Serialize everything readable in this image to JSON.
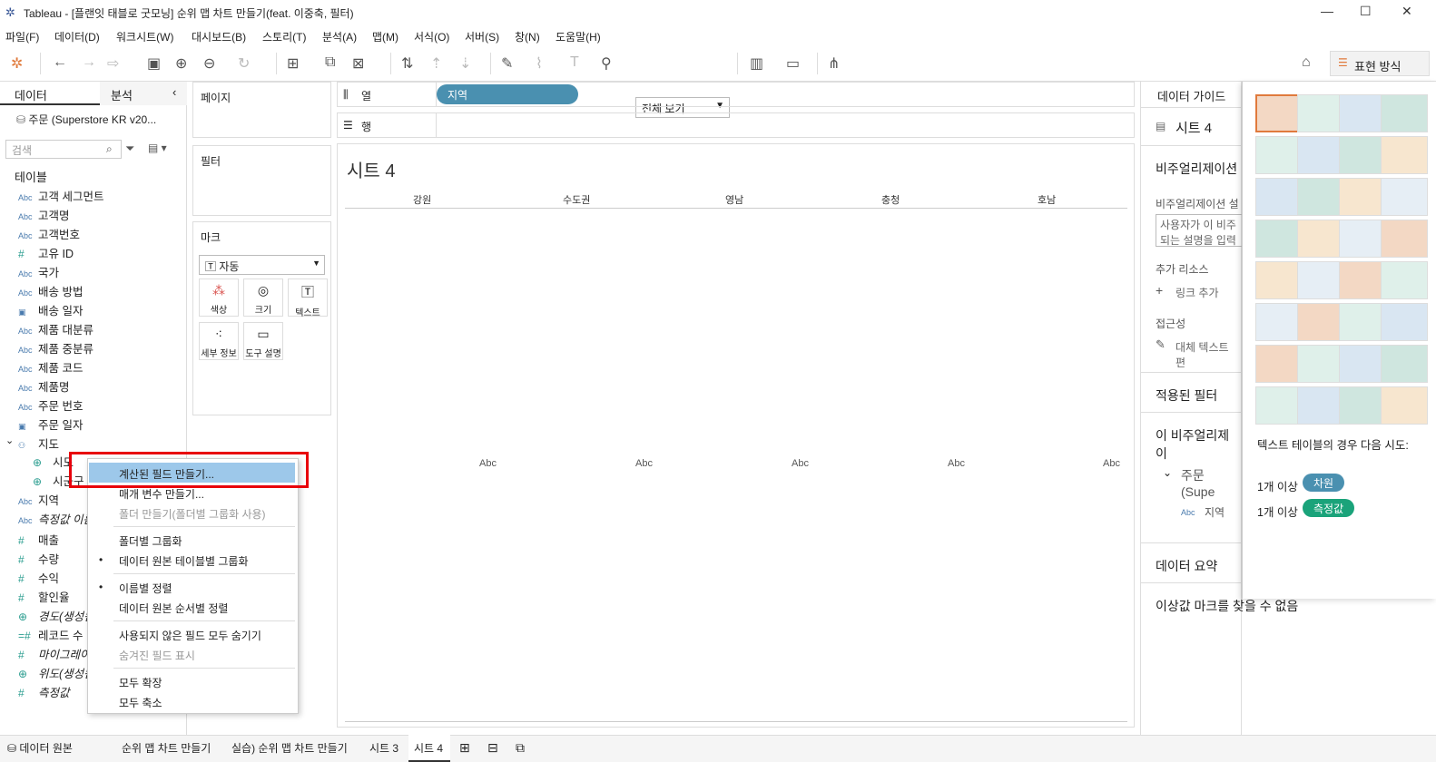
{
  "window": {
    "title": "Tableau - [플랜잇 태블로 굿모닝] 순위 맵 차트 만들기(feat. 이중축, 필터)"
  },
  "menu": [
    "파일(F)",
    "데이터(D)",
    "워크시트(W)",
    "대시보드(B)",
    "스토리(T)",
    "분석(A)",
    "맵(M)",
    "서식(O)",
    "서버(S)",
    "창(N)",
    "도움말(H)"
  ],
  "toolbar": {
    "view_label": "전체 보기",
    "showme_label": "표현 방식"
  },
  "left": {
    "tab_data": "데이터",
    "tab_analysis": "분석",
    "source": "주문 (Superstore KR v20...",
    "search_placeholder": "검색",
    "tables_label": "테이블",
    "fields": [
      {
        "icon": "Abc",
        "name": "고객 세그먼트"
      },
      {
        "icon": "Abc",
        "name": "고객명"
      },
      {
        "icon": "Abc",
        "name": "고객번호"
      },
      {
        "icon": "#",
        "name": "고유 ID"
      },
      {
        "icon": "Abc",
        "name": "국가"
      },
      {
        "icon": "Abc",
        "name": "배송 방법"
      },
      {
        "icon": "cal",
        "name": "배송 일자"
      },
      {
        "icon": "Abc",
        "name": "제품 대분류"
      },
      {
        "icon": "Abc",
        "name": "제품 중분류"
      },
      {
        "icon": "Abc",
        "name": "제품 코드"
      },
      {
        "icon": "Abc",
        "name": "제품명"
      },
      {
        "icon": "Abc",
        "name": "주문 번호"
      },
      {
        "icon": "cal",
        "name": "주문 일자"
      },
      {
        "icon": "hier",
        "name": "지도"
      },
      {
        "icon": "geo",
        "name": "시도"
      },
      {
        "icon": "geo",
        "name": "시군구"
      },
      {
        "icon": "Abc",
        "name": "지역"
      },
      {
        "icon": "Abc",
        "name": "측정값 이름"
      },
      {
        "icon": "#",
        "name": "매출"
      },
      {
        "icon": "#",
        "name": "수량"
      },
      {
        "icon": "#",
        "name": "수익"
      },
      {
        "icon": "#",
        "name": "할인율"
      },
      {
        "icon": "geo",
        "name": "경도(생성됨)"
      },
      {
        "icon": "=#",
        "name": "레코드 수"
      },
      {
        "icon": "#",
        "name": "마이그레이션"
      },
      {
        "icon": "geo",
        "name": "위도(생성됨)"
      },
      {
        "icon": "#",
        "name": "측정값"
      }
    ]
  },
  "shelves": {
    "pages": "페이지",
    "filters": "필터",
    "marks": "마크",
    "mark_type": "자동",
    "mark_buttons": [
      "색상",
      "크기",
      "텍스트",
      "세부 정보",
      "도구 설명"
    ],
    "columns": "열",
    "rows": "행",
    "column_pill": "지역"
  },
  "view": {
    "sheet_title": "시트 4",
    "headers": [
      "강원",
      "수도권",
      "영남",
      "충청",
      "호남"
    ],
    "cell_text": "Abc"
  },
  "guide": {
    "title": "데이터 가이드",
    "sheet": "시트 4",
    "viz_section": "비주얼리제이션",
    "viz_desc_label": "비주얼리제이션 설",
    "desc_placeholder": "사용자가 이 비주\n되는 설명을 입력",
    "resources": "추가 리소스",
    "add_link": "링크 추가",
    "accessibility": "접근성",
    "alt_text": "대체 텍스트 편",
    "applied_filters": "적용된 필터",
    "this_viz": "이 비주얼리제이",
    "source": "주문 (Supe",
    "field": "지역",
    "summary": "데이터 요약",
    "no_outliers": "이상값 마크를 찾을 수 없음"
  },
  "showme": {
    "hint_title": "텍스트 테이블의 경우 다음 시도:",
    "req1": "1개 이상",
    "dim_badge": "차원",
    "req2": "1개 이상",
    "meas_badge": "측정값"
  },
  "context_menu": {
    "items": [
      {
        "label": "계산된 필드 만들기...",
        "state": "hover"
      },
      {
        "label": "매개 변수 만들기...",
        "state": "normal"
      },
      {
        "label": "폴더 만들기(폴더별 그룹화 사용)",
        "state": "disabled"
      },
      {
        "label": "폴더별 그룹화",
        "state": "normal"
      },
      {
        "label": "데이터 원본 테이블별 그룹화",
        "state": "checked"
      },
      {
        "label": "이름별 정렬",
        "state": "checked"
      },
      {
        "label": "데이터 원본 순서별 정렬",
        "state": "normal"
      },
      {
        "label": "사용되지 않은 필드 모두 숨기기",
        "state": "normal"
      },
      {
        "label": "숨겨진 필드 표시",
        "state": "disabled"
      },
      {
        "label": "모두 확장",
        "state": "normal"
      },
      {
        "label": "모두 축소",
        "state": "normal"
      }
    ]
  },
  "bottom_tabs": [
    "데이터 원본",
    "순위 맵 차트 만들기",
    "실습) 순위 맵 차트 만들기",
    "시트 3",
    "시트 4"
  ],
  "colors": {
    "pill": "#4a90b0",
    "dimension": "#4a90b0",
    "measure": "#1aa37a",
    "highlight": "#9dc8ea",
    "annotation": "#e8000b"
  }
}
